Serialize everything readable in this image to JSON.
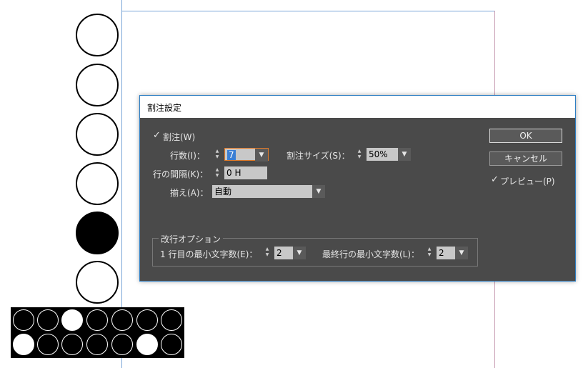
{
  "dialog": {
    "title": "割注設定",
    "warichu_check": "割注(W)",
    "rows_label": "行数(I)：",
    "rows_value": "7",
    "size_label": "割注サイズ(S)：",
    "size_value": "50%",
    "spacing_label": "行の間隔(K)：",
    "spacing_value": "0 H",
    "align_label": "揃え(A)：",
    "align_value": "自動",
    "linebreak_legend": "改行オプション",
    "first_min_label": "1 行目の最小文字数(E)：",
    "first_min_value": "2",
    "last_min_label": "最終行の最小文字数(L)：",
    "last_min_value": "2",
    "ok_label": "OK",
    "cancel_label": "キャンセル",
    "preview_label": "プレビュー(P)"
  },
  "icons": {
    "check": "✓",
    "up": "▲",
    "down": "▼",
    "dropdown": "▼"
  }
}
